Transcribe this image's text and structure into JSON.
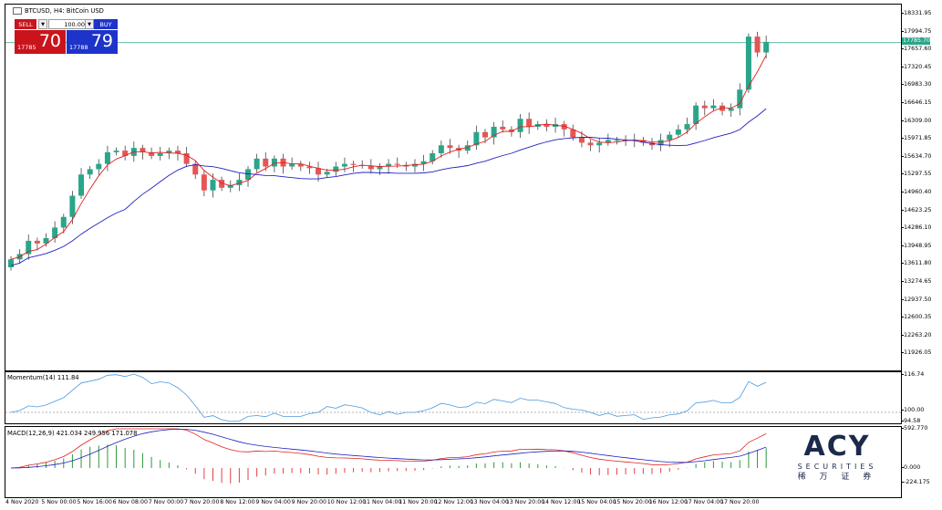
{
  "main": {
    "title": "BTCUSD, H4:  BitCoin USD",
    "price_axis": [
      "18331.95",
      "17994.75",
      "17657.60",
      "17320.45",
      "16983.30",
      "16646.15",
      "16309.00",
      "15971.85",
      "15634.70",
      "15297.55",
      "14960.40",
      "14623.25",
      "14286.10",
      "13948.95",
      "13611.80",
      "13274.65",
      "12937.50",
      "12600.35",
      "12263.20",
      "11926.05"
    ],
    "current_price_tag": "17785.70",
    "line_color": "#2aa58a"
  },
  "trade_panel": {
    "sell_label": "SELL",
    "buy_label": "BUY",
    "quantity": "100.00",
    "sell_small": "17785",
    "sell_big": "70",
    "buy_small": "17788",
    "buy_big": "79",
    "sell_color": "#c9141b",
    "buy_color": "#1e33c9",
    "dropdown_icon": "triangle-down-icon"
  },
  "momentum": {
    "title": "Momentum(14) 111.84",
    "axis": [
      "116.74",
      "100.00",
      "94.58"
    ]
  },
  "macd": {
    "title": "MACD(12,26,9) 421.034 249.956 171.078",
    "axis": [
      "592.770",
      "0.000",
      "-224.175"
    ]
  },
  "time_axis": [
    "4 Nov 2020",
    "5 Nov 00:00",
    "5 Nov 16:00",
    "6 Nov 08:00",
    "7 Nov 00:00",
    "7 Nov 20:00",
    "8 Nov 12:00",
    "9 Nov 04:00",
    "9 Nov 20:00",
    "10 Nov 12:00",
    "11 Nov 04:00",
    "11 Nov 20:00",
    "12 Nov 12:00",
    "13 Nov 04:00",
    "13 Nov 20:00",
    "14 Nov 12:00",
    "15 Nov 04:00",
    "15 Nov 20:00",
    "16 Nov 12:00",
    "17 Nov 04:00",
    "17 Nov 20:00"
  ],
  "logo": {
    "brand": "ACY",
    "sub": "SECURITIES",
    "cn": "稀 万 证 券",
    "color": "#1c2a4a"
  },
  "colors": {
    "bull": "#2aa58a",
    "bear": "#e65555",
    "ma_fast": "#e02020",
    "ma_slow": "#2020c0",
    "momentum": "#4a9ae0"
  }
}
